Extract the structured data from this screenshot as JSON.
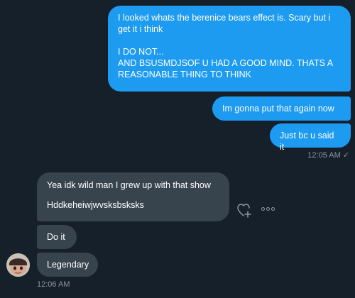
{
  "messages_sent": [
    {
      "lines": [
        "I looked whats the berenice bears effect is. Scary but i get it i think",
        "I DO NOT...",
        "AND BSUSMDJSOF  U HAD A GOOD MIND. THATS A REASONABLE THING TO THINK"
      ]
    },
    {
      "text": "Im gonna put that again now"
    },
    {
      "text": "Just bc u said it"
    }
  ],
  "sent_timestamp": "12:05 AM",
  "sent_status": "✓",
  "messages_received": [
    {
      "lines": [
        "Yea idk wild man I grew up with that show",
        "Hddkeheiwjwvsksbsksks"
      ]
    },
    {
      "text": "Do it"
    },
    {
      "text": "Legendary"
    }
  ],
  "received_timestamp": "12:06 AM",
  "icons": {
    "react": "heart-plus-icon",
    "more": "more-horizontal-icon",
    "read": "checkmark-icon"
  },
  "colors": {
    "background": "#15202b",
    "sent_bubble": "#1d9bf0",
    "received_bubble": "#38444d",
    "timestamp": "#8b98a5"
  }
}
